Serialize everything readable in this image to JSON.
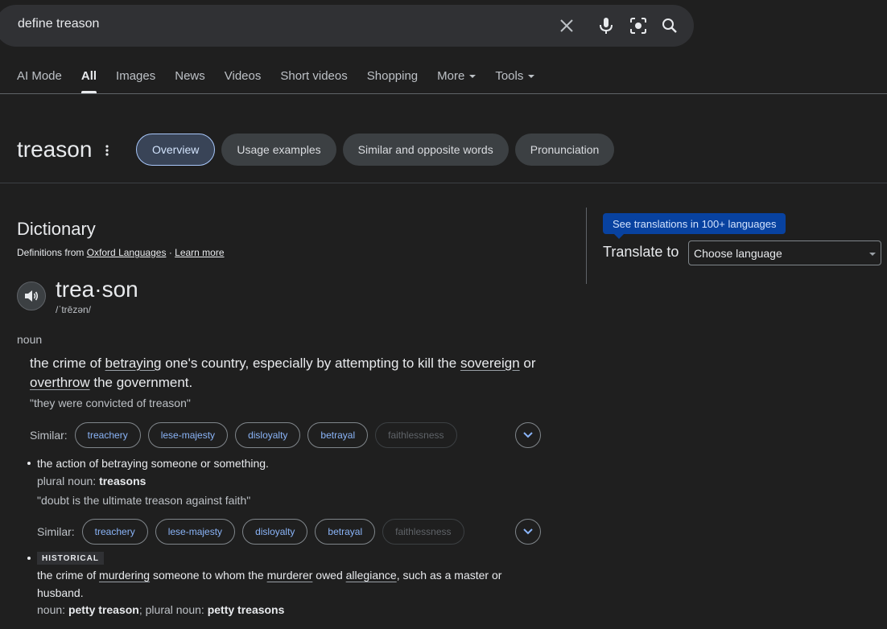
{
  "search": {
    "query": "define treason",
    "icons": [
      "close-icon",
      "microphone-icon",
      "lens-icon",
      "search-icon"
    ]
  },
  "tabs": [
    {
      "label": "AI Mode",
      "active": false
    },
    {
      "label": "All",
      "active": true
    },
    {
      "label": "Images",
      "active": false
    },
    {
      "label": "News",
      "active": false
    },
    {
      "label": "Videos",
      "active": false
    },
    {
      "label": "Short videos",
      "active": false
    },
    {
      "label": "Shopping",
      "active": false
    },
    {
      "label": "More",
      "active": false,
      "dropdown": true
    },
    {
      "label": "Tools",
      "active": false,
      "dropdown": true
    }
  ],
  "word_header": {
    "word": "treason",
    "chips": [
      {
        "label": "Overview",
        "active": true
      },
      {
        "label": "Usage examples",
        "active": false
      },
      {
        "label": "Similar and opposite words",
        "active": false
      },
      {
        "label": "Pronunciation",
        "active": false
      }
    ]
  },
  "dictionary": {
    "title": "Dictionary",
    "defs_prefix": "Definitions from",
    "source": "Oxford Languages",
    "separator": "·",
    "learn_more": "Learn more",
    "headword": "trea·son",
    "phonetic": "/ˈtrēzən/",
    "part_of_speech": "noun",
    "sense1": {
      "p1": "the crime of ",
      "l1": "betraying",
      "p2": " one's country, especially by attempting to kill the ",
      "l2": "sovereign",
      "p3": " or ",
      "l3": "overthrow",
      "p4": " the government.",
      "example": "\"they were convicted of treason\"",
      "similar_label": "Similar:",
      "similar": [
        "treachery",
        "lese-majesty",
        "disloyalty",
        "betrayal"
      ],
      "similar_muted": "faithlessness"
    },
    "sense2": {
      "text": "the action of betraying someone or something.",
      "plural_prefix": "plural noun:",
      "plural": "treasons",
      "example": "\"doubt is the ultimate treason against faith\"",
      "similar_label": "Similar:",
      "similar": [
        "treachery",
        "lese-majesty",
        "disloyalty",
        "betrayal"
      ],
      "similar_muted": "faithlessness"
    },
    "sense3": {
      "badge": "HISTORICAL",
      "p1": "the crime of ",
      "l1": "murdering",
      "p2": " someone to whom the ",
      "l2": "murderer",
      "p3": " owed ",
      "l3": "allegiance",
      "p4": ", such as a master or husband.",
      "noun_prefix": "noun:",
      "noun": "petty treason",
      "sep": ";",
      "plural_prefix": "plural noun:",
      "plural": "petty treasons"
    }
  },
  "translate": {
    "tooltip": "See translations in 100+ languages",
    "label": "Translate to",
    "select_value": "Choose language"
  },
  "colors": {
    "background": "#1f1f1f",
    "link": "#8ab4f8",
    "tooltip": "#0842a0"
  }
}
